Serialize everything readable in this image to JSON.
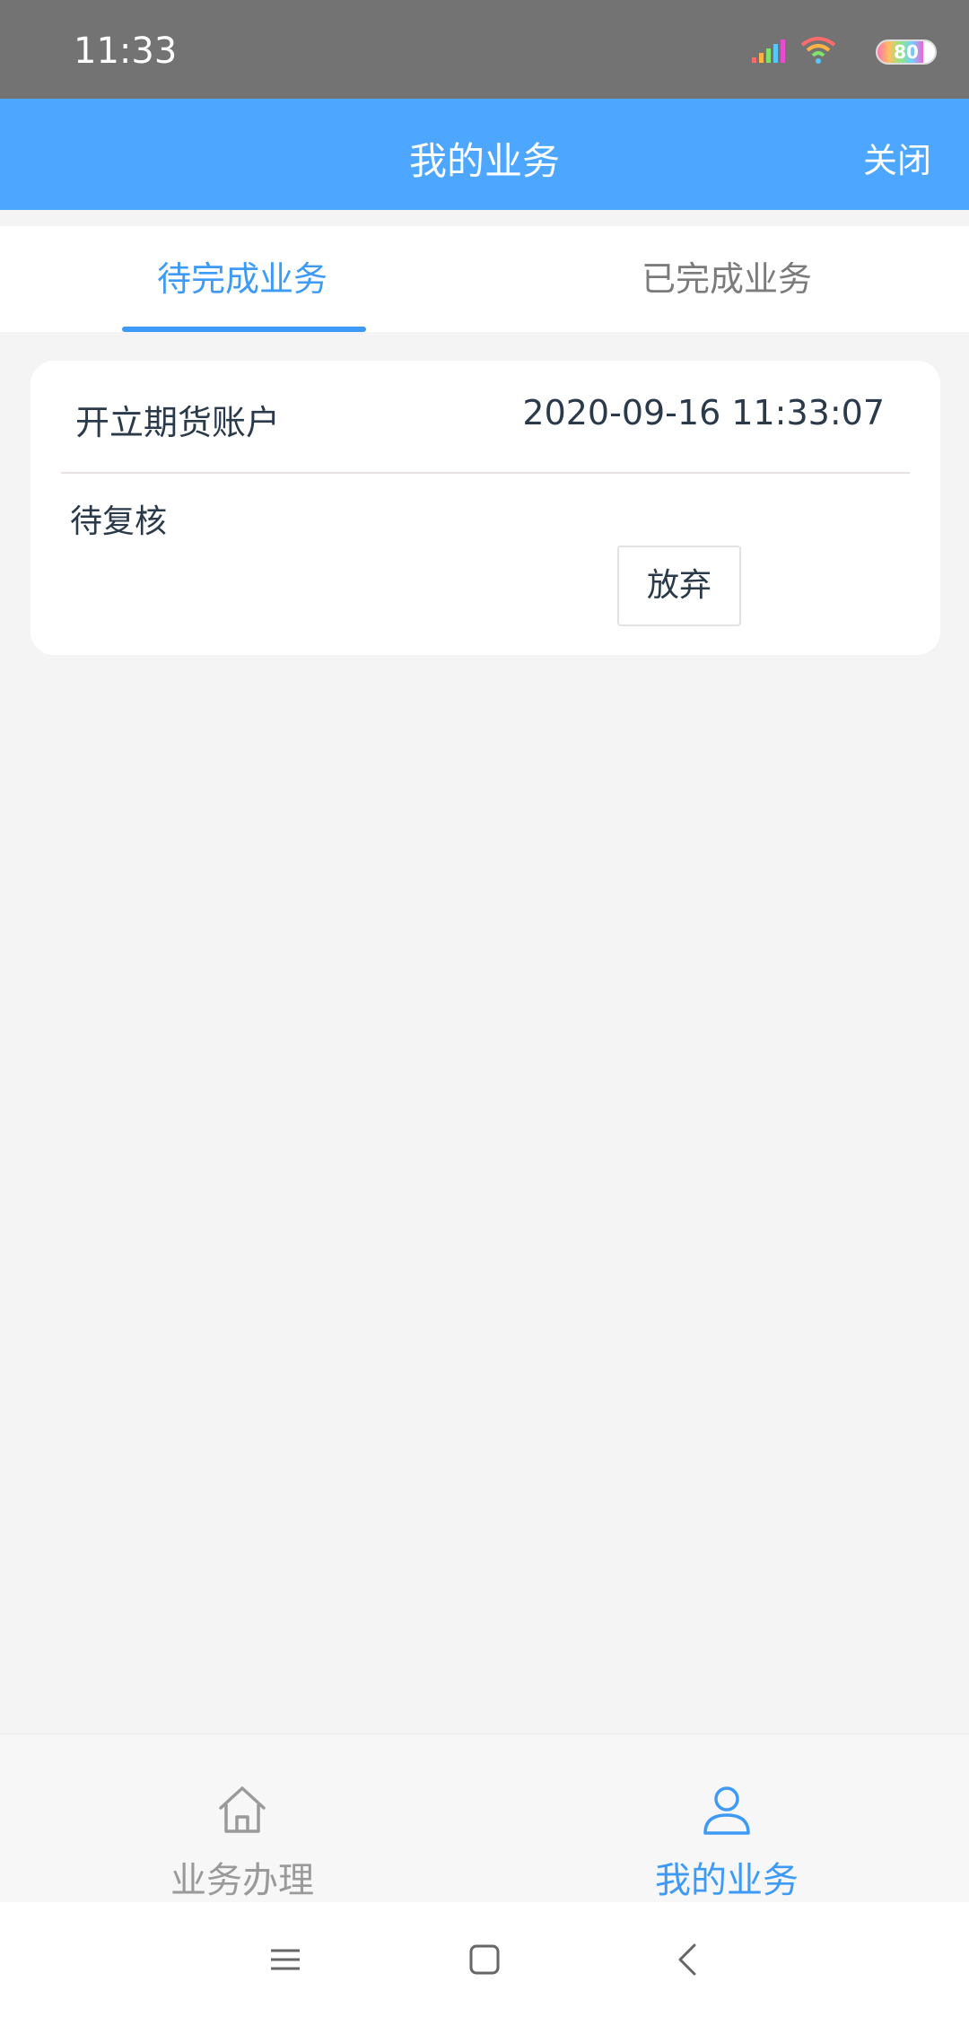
{
  "status_bar": {
    "time": "11:33",
    "battery": "80",
    "icons": [
      "signal-icon",
      "wifi-icon",
      "battery-icon"
    ]
  },
  "app_bar": {
    "title": "我的业务",
    "close_label": "关闭"
  },
  "tabs": [
    {
      "label": "待完成业务",
      "active": true
    },
    {
      "label": "已完成业务",
      "active": false
    }
  ],
  "business_list": [
    {
      "title": "开立期货账户",
      "time": "2020-09-16 11:33:07",
      "status": "待复核",
      "action_label": "放弃"
    }
  ],
  "bottom_nav": [
    {
      "label": "业务办理",
      "icon": "home-icon",
      "active": false
    },
    {
      "label": "我的业务",
      "icon": "user-icon",
      "active": true
    }
  ],
  "system_nav": [
    "menu-icon",
    "home-square-icon",
    "back-icon"
  ],
  "colors": {
    "primary": "#4da6ff",
    "accent": "#3e9af7",
    "background": "#f4f4f4",
    "status_bar": "#737373"
  }
}
